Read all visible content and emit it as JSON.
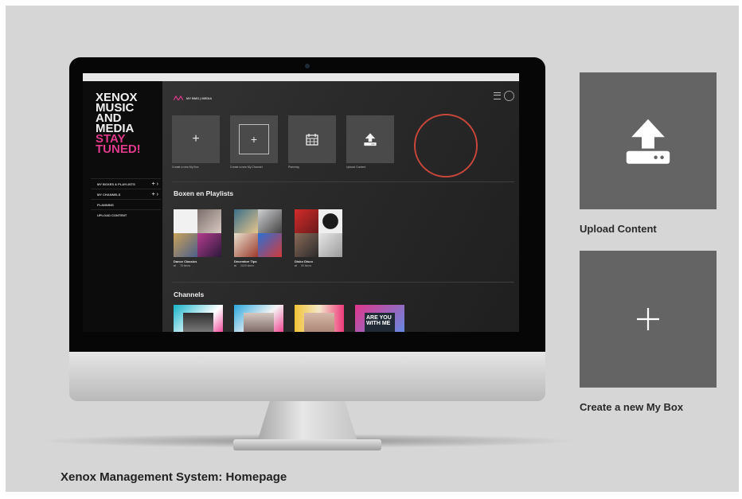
{
  "caption": "Xenox Management System: Homepage",
  "app": {
    "logo_lines": [
      "XENOX",
      "MUSIC",
      "AND",
      "MEDIA",
      "STAY",
      "TUNED!"
    ],
    "breadcrumb": "MY BMS | MEDIA",
    "sidebar": {
      "items": [
        {
          "label": "MY BOXES & PLAYLISTS",
          "controls": "+ ›"
        },
        {
          "label": "MY CHANNELS",
          "controls": "+ ›"
        },
        {
          "label": "PLANNING",
          "controls": ""
        },
        {
          "label": "UPLOAD CONTENT",
          "controls": ""
        }
      ]
    },
    "tiles": [
      {
        "label": "Create a new My Box",
        "icon": "plus-icon"
      },
      {
        "label": "Create a new My Channel",
        "icon": "plus-icon"
      },
      {
        "label": "Planning",
        "icon": "calendar-icon"
      },
      {
        "label": "Upload Content",
        "icon": "upload-icon"
      }
    ],
    "sections": {
      "playlists_title": "Boxen en Playlists",
      "channels_title": "Channels"
    },
    "playlists": [
      {
        "name": "Dance Classics",
        "count": "78 items"
      },
      {
        "name": "December Tips",
        "count": "2029 items"
      },
      {
        "name": "Disko Disco",
        "count": "90 items"
      }
    ],
    "channel_art_text": "ARE YOU WITH ME"
  },
  "side_panels": [
    {
      "label": "Upload Content",
      "icon": "upload-icon"
    },
    {
      "label": "Create a new My Box",
      "icon": "plus-icon"
    }
  ],
  "colors": {
    "accent_pink": "#e13a8c",
    "highlight_ring": "#c8463a",
    "panel_gray": "#646464",
    "background": "#d6d6d6"
  }
}
